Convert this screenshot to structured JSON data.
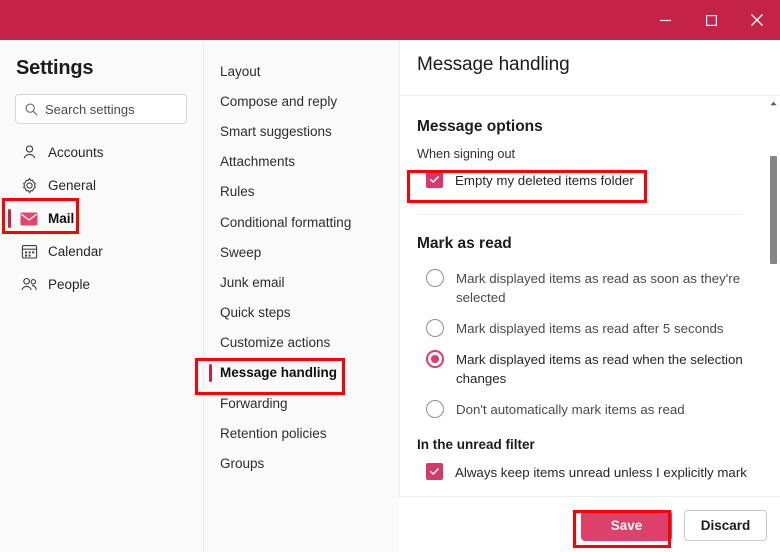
{
  "window": {
    "controls": [
      {
        "name": "minimize",
        "glyph": "minimize-icon"
      },
      {
        "name": "maximize",
        "glyph": "maximize-icon"
      },
      {
        "name": "close",
        "glyph": "close-icon"
      }
    ],
    "titlebar_color": "#c42347"
  },
  "sidebar": {
    "title": "Settings",
    "search": {
      "placeholder": "Search settings",
      "value": "",
      "icon": "search-icon"
    },
    "items": [
      {
        "label": "Accounts",
        "icon": "person-icon",
        "selected": false
      },
      {
        "label": "General",
        "icon": "gear-icon",
        "selected": false
      },
      {
        "label": "Mail",
        "icon": "mail-icon",
        "selected": true
      },
      {
        "label": "Calendar",
        "icon": "calendar-icon",
        "selected": false
      },
      {
        "label": "People",
        "icon": "people-icon",
        "selected": false
      }
    ]
  },
  "subnav": {
    "items": [
      {
        "label": "Layout",
        "selected": false
      },
      {
        "label": "Compose and reply",
        "selected": false
      },
      {
        "label": "Smart suggestions",
        "selected": false
      },
      {
        "label": "Attachments",
        "selected": false
      },
      {
        "label": "Rules",
        "selected": false
      },
      {
        "label": "Conditional formatting",
        "selected": false
      },
      {
        "label": "Sweep",
        "selected": false
      },
      {
        "label": "Junk email",
        "selected": false
      },
      {
        "label": "Quick steps",
        "selected": false
      },
      {
        "label": "Customize actions",
        "selected": false
      },
      {
        "label": "Message handling",
        "selected": true
      },
      {
        "label": "Forwarding",
        "selected": false
      },
      {
        "label": "Retention policies",
        "selected": false
      },
      {
        "label": "Groups",
        "selected": false
      }
    ]
  },
  "panel": {
    "title": "Message handling",
    "message_options": {
      "heading": "Message options",
      "sublabel": "When signing out",
      "checkbox": {
        "label": "Empty my deleted items folder",
        "checked": true
      }
    },
    "mark_as_read": {
      "heading": "Mark as read",
      "options": [
        {
          "label": "Mark displayed items as read as soon as they're selected",
          "selected": false
        },
        {
          "label": "Mark displayed items as read after 5 seconds",
          "selected": false
        },
        {
          "label": "Mark displayed items as read when the selection changes",
          "selected": true
        },
        {
          "label": "Don't automatically mark items as read",
          "selected": false
        }
      ]
    },
    "unread_filter": {
      "heading": "In the unread filter",
      "checkbox": {
        "label": "Always keep items unread unless I explicitly mark",
        "checked": true
      }
    }
  },
  "footer": {
    "save_label": "Save",
    "discard_label": "Discard",
    "save_color": "#dd4068"
  },
  "annotations": {
    "highlight_color": "#ff0000",
    "boxes": [
      "mail-sidebar-item",
      "empty-deleted-items-checkbox",
      "message-handling-subnav-item",
      "save-button"
    ]
  }
}
